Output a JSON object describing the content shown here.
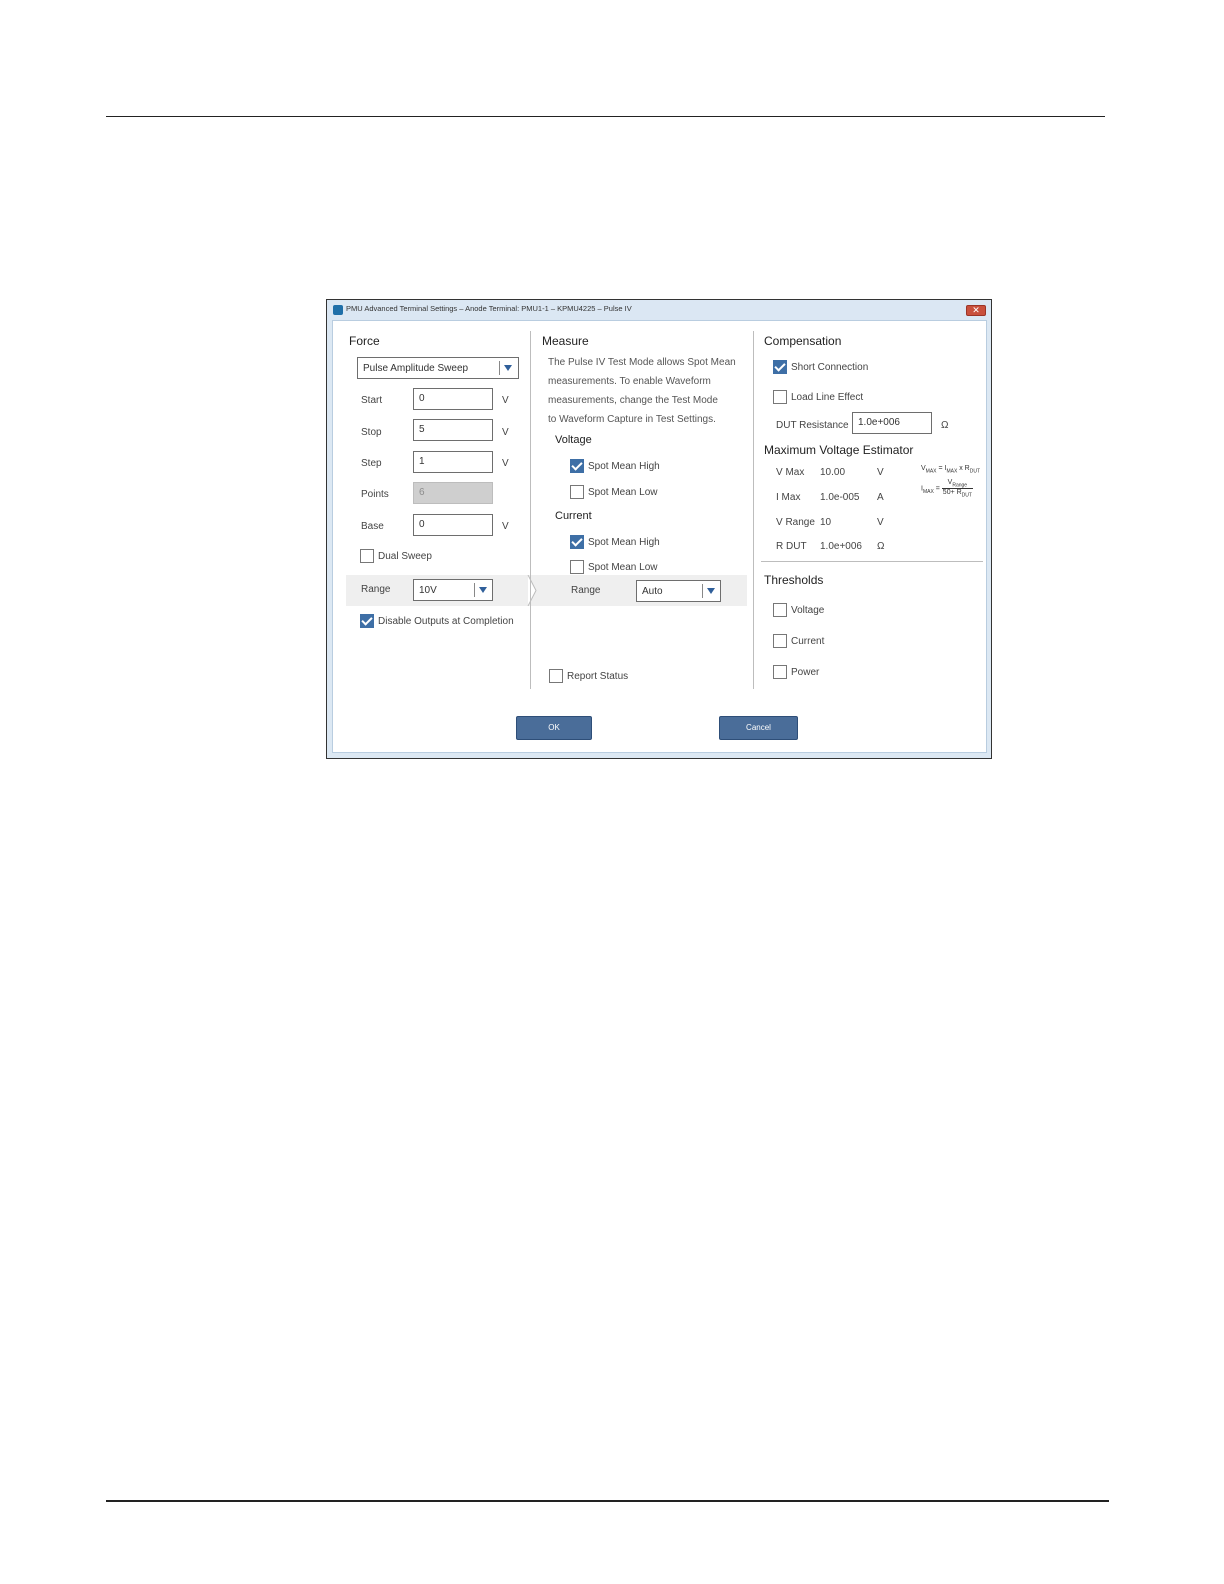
{
  "window": {
    "title": "PMU Advanced Terminal Settings – Anode Terminal: PMU1-1 – KPMU4225 – Pulse IV",
    "close_glyph": "✕"
  },
  "force": {
    "header": "Force",
    "mode": "Pulse Amplitude Sweep",
    "fields": {
      "start": {
        "label": "Start",
        "value": "0",
        "unit": "V"
      },
      "stop": {
        "label": "Stop",
        "value": "5",
        "unit": "V"
      },
      "step": {
        "label": "Step",
        "value": "1",
        "unit": "V"
      },
      "points": {
        "label": "Points",
        "value": "6"
      },
      "base": {
        "label": "Base",
        "value": "0",
        "unit": "V"
      }
    },
    "dual_sweep": {
      "label": "Dual Sweep",
      "checked": false
    },
    "range": {
      "label": "Range",
      "value": "10V"
    },
    "disable_outputs": {
      "label": "Disable Outputs at Completion",
      "checked": true
    }
  },
  "measure": {
    "header": "Measure",
    "info_lines": [
      "The Pulse IV Test Mode allows Spot Mean",
      "measurements. To enable Waveform",
      "measurements, change the Test Mode",
      "to Waveform Capture in Test Settings."
    ],
    "voltage": {
      "header": "Voltage",
      "spot_mean_high": {
        "label": "Spot Mean High",
        "checked": true
      },
      "spot_mean_low": {
        "label": "Spot Mean Low",
        "checked": false
      }
    },
    "current": {
      "header": "Current",
      "spot_mean_high": {
        "label": "Spot Mean High",
        "checked": true
      },
      "spot_mean_low": {
        "label": "Spot Mean Low",
        "checked": false
      }
    },
    "range": {
      "label": "Range",
      "value": "Auto"
    },
    "report_status": {
      "label": "Report Status",
      "checked": false
    }
  },
  "compensation": {
    "header": "Compensation",
    "short_connection": {
      "label": "Short Connection",
      "checked": true
    },
    "load_line_effect": {
      "label": "Load Line Effect",
      "checked": false
    },
    "dut_resistance": {
      "label": "DUT Resistance",
      "value": "1.0e+006",
      "unit": "Ω"
    }
  },
  "estimator": {
    "header": "Maximum Voltage Estimator",
    "rows": [
      {
        "label": "V Max",
        "value": "10.00",
        "unit": "V"
      },
      {
        "label": "I  Max",
        "value": "1.0e-005",
        "unit": "A"
      },
      {
        "label": "V Range",
        "value": "10",
        "unit": "V"
      },
      {
        "label": "R DUT",
        "value": "1.0e+006",
        "unit": "Ω"
      }
    ],
    "formula": {
      "v_max": "V",
      "v_max_sub": "MAX",
      "eq1": " = I",
      "i_sub": "MAX",
      "times": " x R",
      "r_sub": "DUT",
      "i_max": "I",
      "i_max_sub": "MAX",
      "eq2": " =",
      "num": "V",
      "num_sub": "Range",
      "den": "50+ R",
      "den_sub": "DUT"
    }
  },
  "thresholds": {
    "header": "Thresholds",
    "voltage": {
      "label": "Voltage",
      "checked": false
    },
    "current": {
      "label": "Current",
      "checked": false
    },
    "power": {
      "label": "Power",
      "checked": false
    }
  },
  "buttons": {
    "ok": "OK",
    "cancel": "Cancel"
  },
  "colors": {
    "accent": "#3e6fa6",
    "button": "#4a6d99",
    "title_bar": "#dbe7f3"
  }
}
